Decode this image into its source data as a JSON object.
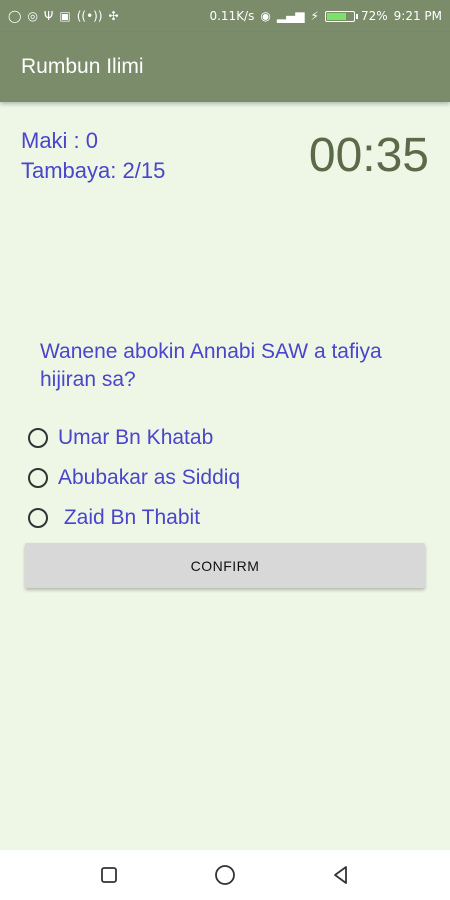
{
  "status_bar": {
    "network_speed": "0.11K/s",
    "battery_percent": "72%",
    "battery_level": 0.72,
    "time": "9:21 PM",
    "colors": {
      "bar_bg": "#7b8c6b",
      "battery_fill": "#7be36a"
    }
  },
  "app_bar": {
    "title": "Rumbun Ilimi"
  },
  "quiz": {
    "score_text": "Maki : 0",
    "question_counter": "Tambaya: 2/15",
    "timer": "00:35",
    "question": "Wanene abokin Annabi SAW a tafiya hijiran sa?",
    "options": [
      {
        "label": "Umar Bn Khatab",
        "selected": false
      },
      {
        "label": "Abubakar as Siddiq",
        "selected": false
      },
      {
        "label": " Zaid Bn Thabit",
        "selected": false
      }
    ],
    "confirm_label": "CONFIRM"
  },
  "nav_bar": {
    "icons": [
      "square-recents-icon",
      "circle-home-icon",
      "triangle-back-icon"
    ]
  },
  "colors": {
    "accent_text": "#4b45cc",
    "timer_text": "#5b6b4a",
    "background": "#eef6e6"
  }
}
